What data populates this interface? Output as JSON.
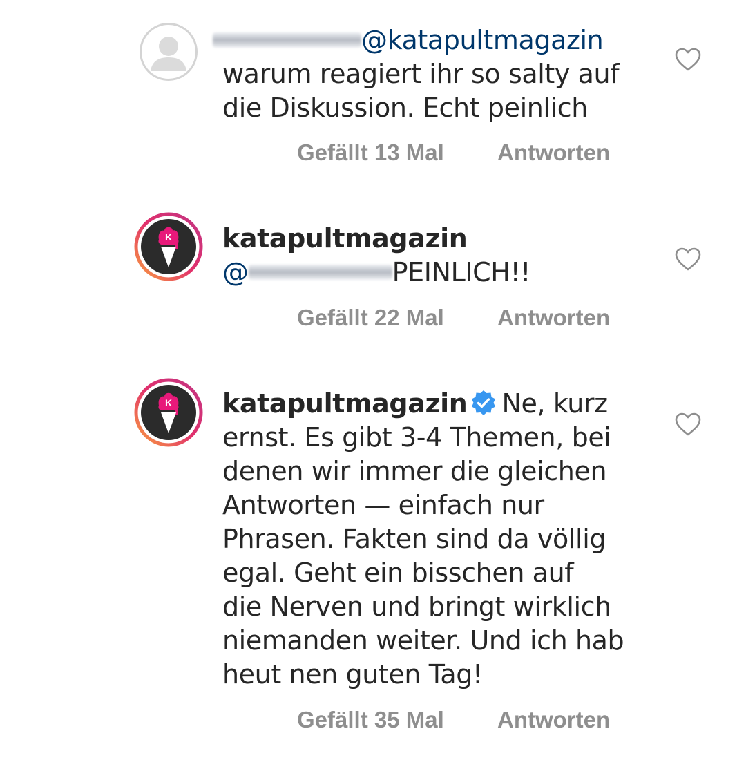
{
  "comments": [
    {
      "username": "",
      "mention": "@katapultmagazin",
      "text_line1": "warum reagiert ihr so salty auf",
      "text_line2": "die Diskussion. Echt peinlich",
      "likes": "Gefällt 13 Mal",
      "reply": "Antworten"
    },
    {
      "username": "katapultmagazin",
      "mention": "@",
      "text": "PEINLICH!!",
      "likes": "Gefällt 22 Mal",
      "reply": "Antworten"
    },
    {
      "username": "katapultmagazin",
      "text_first": "Ne, kurz",
      "lines": [
        "ernst. Es gibt 3-4 Themen, bei",
        "denen wir immer die gleichen",
        "Antworten — einfach nur",
        "Phrasen. Fakten sind da völlig",
        "egal. Geht ein bisschen auf",
        "die Nerven und bringt wirklich",
        "niemanden weiter. Und ich hab",
        "heut nen guten Tag!"
      ],
      "likes": "Gefällt 35 Mal",
      "reply": "Antworten"
    }
  ],
  "colors": {
    "text": "#262626",
    "meta": "#8e8e8e",
    "mention": "#00376b",
    "verified": "#3897f0",
    "logo_pink": "#e8197a"
  }
}
